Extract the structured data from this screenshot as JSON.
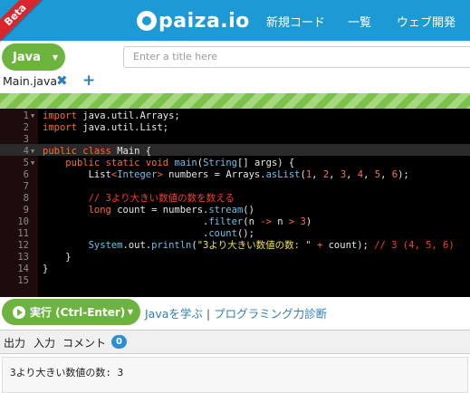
{
  "header": {
    "beta": "Beta",
    "logo": "paiza.io",
    "nav": [
      "新規コード",
      "一覧",
      "ウェブ開発"
    ]
  },
  "toolbar": {
    "language": "Java",
    "title_placeholder": "Enter a title here"
  },
  "tabs": {
    "file": "Main.java",
    "close": "✖",
    "add": "+"
  },
  "editor": {
    "line_numbers": [
      "1",
      "2",
      "3",
      "4",
      "5",
      "6",
      "7",
      "8",
      "9",
      "10",
      "11",
      "12",
      "13",
      "14",
      "15"
    ],
    "current_line": 4
  },
  "run": {
    "label": "実行 (Ctrl-Enter)",
    "learn_link": "Javaを学ぶ",
    "separator": "|",
    "diagnosis_link": "プログラミング力診断"
  },
  "output": {
    "tabs": [
      "出力",
      "入力",
      "コメント"
    ],
    "comment_count": "0",
    "text": "3より大きい数値の数: 3"
  }
}
